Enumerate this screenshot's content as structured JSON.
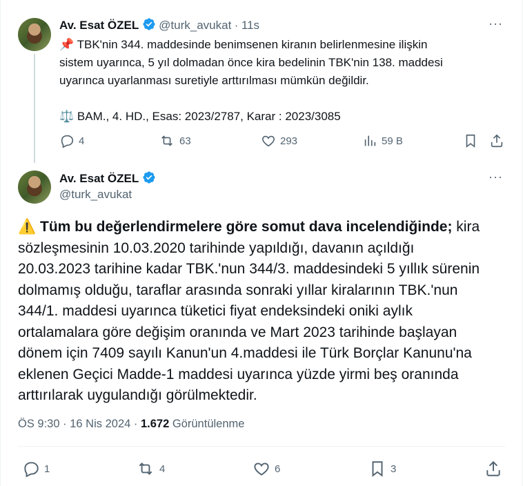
{
  "reply_tweet": {
    "author_name": "Av. Esat ÖZEL",
    "author_handle": "@turk_avukat",
    "separator": "·",
    "time": "11s",
    "pin_emoji": "📌",
    "text_lines": [
      "TBK'nin 344. maddesinde benimsenen kiranın belirlenmesine ilişkin",
      "sistem uyarınca, 5 yıl dolmadan önce kira bedelinin TBK'nin 138. maddesi",
      "uyarınca uyarlanması suretiyle arttırılması mümkün değildir."
    ],
    "scale_emoji": "⚖️",
    "citation": "BAM., 4. HD., Esas: 2023/2787, Karar : 2023/3085",
    "replies": "4",
    "reposts": "63",
    "likes": "293",
    "views": "59 B",
    "more": "···"
  },
  "main_tweet": {
    "author_name": "Av. Esat ÖZEL",
    "author_handle": "@turk_avukat",
    "more": "···",
    "warning_emoji": "⚠️",
    "bold_text": "Tüm bu değerlendirmelere göre somut dava incelendiğinde;",
    "lines": [
      " kira",
      "sözleşmesinin 10.03.2020 tarihinde yapıldığı, davanın açıldığı",
      "20.03.2023 tarihine kadar TBK.'nun 344/3. maddesindeki 5 yıllık sürenin",
      "dolmamış olduğu, taraflar arasında sonraki yıllar kiralarının TBK.'nun",
      "344/1. maddesi uyarınca tüketici fiyat endeksindeki oniki aylık",
      "ortalamalara göre değişim oranında ve Mart 2023 tarihinde başlayan",
      "dönem için 7409 sayılı Kanun'un 4.maddesi ile Türk Borçlar Kanunu'na",
      "eklenen Geçici Madde-1 maddesi uyarınca yüzde yirmi beş oranında",
      "arttırılarak uygulandığı görülmektedir."
    ],
    "time": "ÖS 9:30",
    "dot": "·",
    "date": "16 Nis 2024",
    "views_count": "1.672",
    "views_label": "Görüntülenme",
    "replies": "1",
    "reposts": "4",
    "likes": "6",
    "bookmarks": "3"
  },
  "colors": {
    "verified": "#1d9bf0",
    "muted": "#536471",
    "text": "#0f1419"
  }
}
